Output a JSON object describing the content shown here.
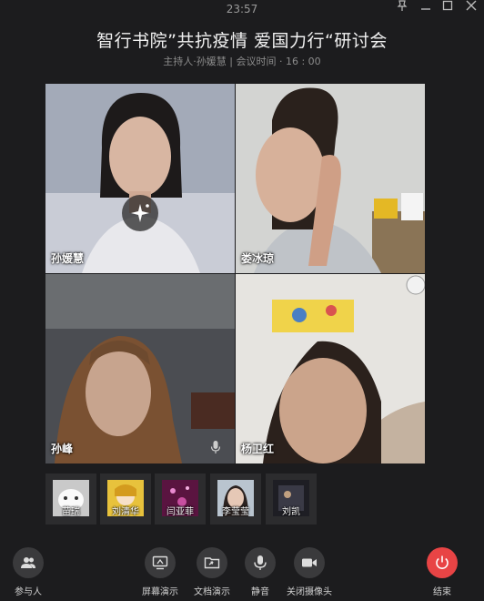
{
  "window": {
    "clock": "23:57"
  },
  "meeting": {
    "title": "智行书院”共抗疫情  爱国力行“研讨会",
    "subtitle": "主持人·孙媛慧 | 会议时间 · 16 : 00"
  },
  "video_tiles": [
    {
      "name": "孙媛慧"
    },
    {
      "name": "娄冰琼"
    },
    {
      "name": "孙峰"
    },
    {
      "name": "杨卫红"
    }
  ],
  "participants": [
    {
      "name": "苗瑞"
    },
    {
      "name": "刘清华"
    },
    {
      "name": "闫亚菲"
    },
    {
      "name": "李莹莹"
    },
    {
      "name": "刘凯"
    }
  ],
  "toolbar": {
    "participants_label": "参与人",
    "screen_share_label": "屏幕演示",
    "doc_share_label": "文档演示",
    "mute_label": "静音",
    "camera_off_label": "关闭摄像头",
    "end_label": "结束"
  },
  "colors": {
    "background": "#1c1c1e",
    "end_button": "#e84445",
    "tile_bg": "#2c2c2e"
  }
}
